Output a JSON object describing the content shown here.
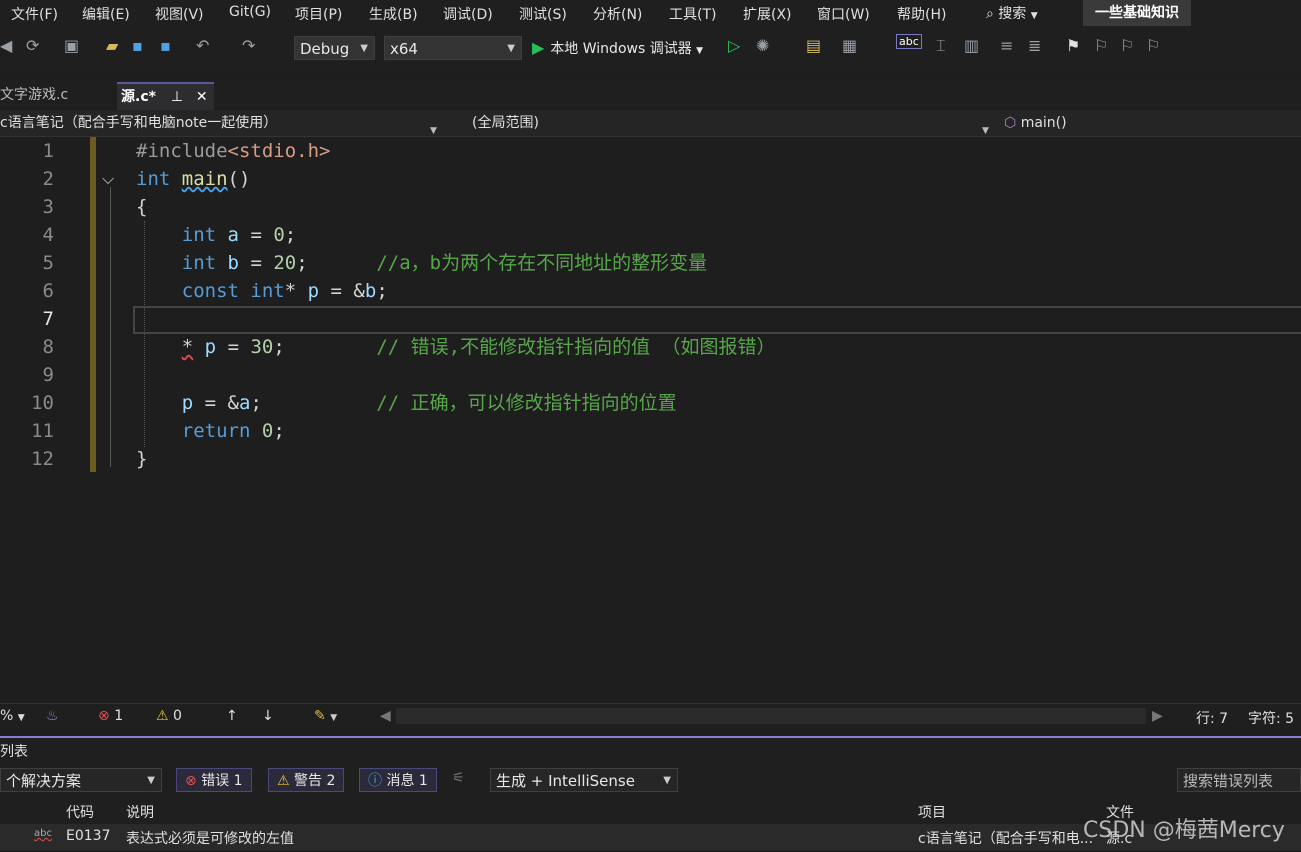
{
  "menu": [
    "文件(F)",
    "编辑(E)",
    "视图(V)",
    "Git(G)",
    "项目(P)",
    "生成(B)",
    "调试(D)",
    "测试(S)",
    "分析(N)",
    "工具(T)",
    "扩展(X)",
    "窗口(W)",
    "帮助(H)"
  ],
  "search_label": "搜索",
  "solution_name": "一些基础知识",
  "toolbar": {
    "config": "Debug",
    "platform": "x64",
    "run_label": "本地 Windows 调试器"
  },
  "tabs": {
    "inactive": "文字游戏.c",
    "active": "源.c*"
  },
  "navbar": {
    "project": "c语言笔记（配合手写和电脑note一起使用）",
    "scope": "(全局范围)",
    "member": "main()"
  },
  "editor": {
    "line_numbers": [
      "1",
      "2",
      "3",
      "4",
      "5",
      "6",
      "7",
      "8",
      "9",
      "10",
      "11",
      "12"
    ],
    "current_line": "7",
    "code": {
      "l1_pp": "#include",
      "l1_inc": "<stdio.h>",
      "l2_kw": "int",
      "l2_fn": "main",
      "l2_rest": "()",
      "l3": "{",
      "l4_kw": "int",
      "l4_var": "a",
      "l4_op": " = ",
      "l4_num": "0",
      "l4_end": ";",
      "l5_kw": "int",
      "l5_var": "b",
      "l5_op": " = ",
      "l5_num": "20",
      "l5_end": ";",
      "l5_cm": "//a，b为两个存在不同地址的整形变量",
      "l6_kw": "const",
      "l6_kw2": "int",
      "l6_ptr": "* ",
      "l6_var": "p",
      "l6_op": " = &",
      "l6_var2": "b",
      "l6_end": ";",
      "l8_star": "*",
      "l8_var": "p",
      "l8_op": " = ",
      "l8_num": "30",
      "l8_end": ";",
      "l8_cm": "// 错误,不能修改指针指向的值 （如图报错）",
      "l10_var": "p",
      "l10_op": " = &",
      "l10_var2": "a",
      "l10_end": ";",
      "l10_cm": "// 正确，可以修改指针指向的位置",
      "l11_kw": "return",
      "l11_num": "0",
      "l11_end": ";",
      "l12": "}"
    }
  },
  "status": {
    "zoom": "%",
    "errors": "1",
    "warnings": "0",
    "line": "行: 7",
    "col": "字符: 5"
  },
  "error_list": {
    "title": "列表",
    "scope": "个解决方案",
    "errors_btn": "错误 1",
    "warnings_btn": "警告 2",
    "messages_btn": "消息 1",
    "build_filter": "生成 + IntelliSense",
    "search_placeholder": "搜索错误列表",
    "columns": {
      "code": "代码",
      "desc": "说明",
      "project": "项目",
      "file": "文件"
    },
    "row": {
      "code": "E0137",
      "desc": "表达式必须是可修改的左值",
      "project": "c语言笔记（配合手写和电...",
      "file": "源.c"
    }
  },
  "watermark": "CSDN @梅茜Mercy"
}
